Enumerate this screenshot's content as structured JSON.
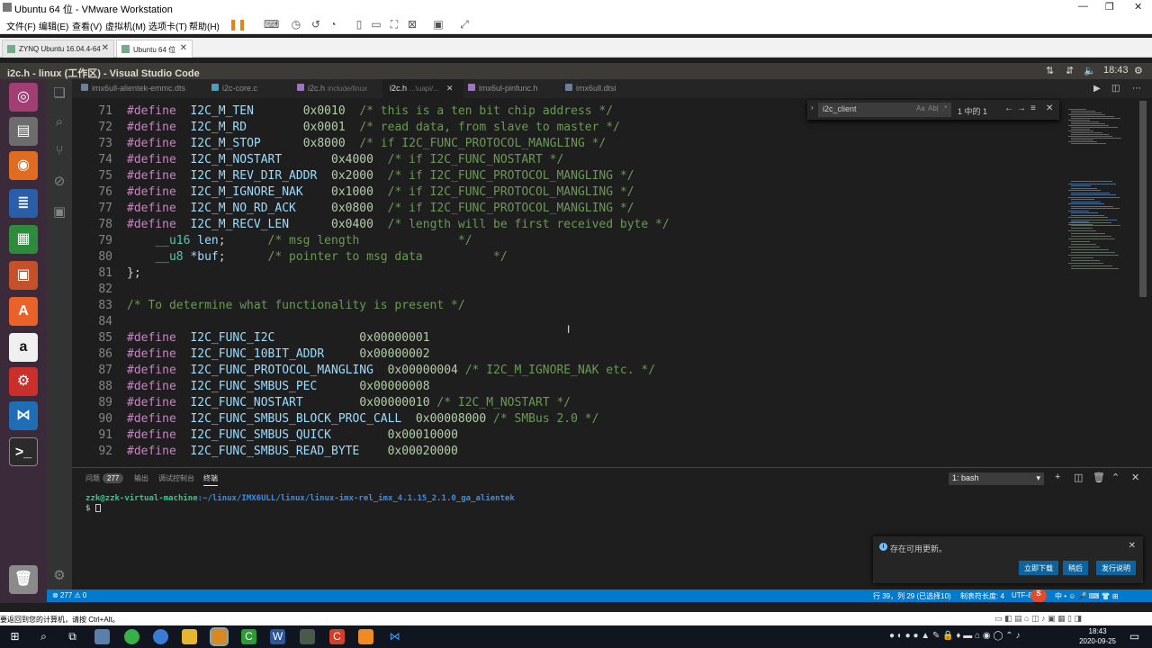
{
  "vm": {
    "window_title": "Ubuntu 64 位 - VMware Workstation",
    "menu": [
      "文件(F)",
      "编辑(E)",
      "查看(V)",
      "虚拟机(M)",
      "选项卡(T)",
      "帮助(H)"
    ],
    "tabs": [
      {
        "label": "ZYNQ Ubuntu 16.04.4-64"
      },
      {
        "label": "Ubuntu 64 位"
      }
    ],
    "hint": "要返回到您的计算机，请按 Ctrl+Alt。"
  },
  "ubuntu": {
    "window_title": "i2c.h - linux (工作区) - Visual Studio Code",
    "time": "18:43"
  },
  "editor_tabs": [
    {
      "label": "imx6ull-alientek-emmc.dts",
      "desc": "",
      "color": "#6b7e9a"
    },
    {
      "label": "i2c-core.c",
      "desc": "",
      "color": "#519aba"
    },
    {
      "label": "i2c.h",
      "desc": "include/linux",
      "color": "#a074c4"
    },
    {
      "label": "i2c.h",
      "desc": "...\\uapi/...",
      "color": "#a074c4"
    },
    {
      "label": "imx6ul-pinfunc.h",
      "desc": "",
      "color": "#a074c4"
    },
    {
      "label": "imx6ull.dtsi",
      "desc": "",
      "color": "#6b7e9a"
    }
  ],
  "find": {
    "value": "i2c_client",
    "opts": [
      "Aa",
      "Ab|",
      ".*"
    ],
    "count": "1 中的 1"
  },
  "code_lines": [
    {
      "n": "71",
      "parts": [
        [
          "kw",
          "#define"
        ],
        [
          "",
          "  "
        ],
        [
          "mac",
          "I2C_M_TEN"
        ],
        [
          "",
          "       "
        ],
        [
          "num",
          "0x0010"
        ],
        [
          "cm",
          "  /* this is a ten bit chip address */"
        ]
      ]
    },
    {
      "n": "72",
      "parts": [
        [
          "kw",
          "#define"
        ],
        [
          "",
          "  "
        ],
        [
          "mac",
          "I2C_M_RD"
        ],
        [
          "",
          "        "
        ],
        [
          "num",
          "0x0001"
        ],
        [
          "cm",
          "  /* read data, from slave to master */"
        ]
      ]
    },
    {
      "n": "73",
      "parts": [
        [
          "kw",
          "#define"
        ],
        [
          "",
          "  "
        ],
        [
          "mac",
          "I2C_M_STOP"
        ],
        [
          "",
          "      "
        ],
        [
          "num",
          "0x8000"
        ],
        [
          "cm",
          "  /* if I2C_FUNC_PROTOCOL_MANGLING */"
        ]
      ]
    },
    {
      "n": "74",
      "parts": [
        [
          "kw",
          "#define"
        ],
        [
          "",
          "  "
        ],
        [
          "mac",
          "I2C_M_NOSTART"
        ],
        [
          "",
          "       "
        ],
        [
          "num",
          "0x4000"
        ],
        [
          "cm",
          "  /* if I2C_FUNC_NOSTART */"
        ]
      ]
    },
    {
      "n": "75",
      "parts": [
        [
          "kw",
          "#define"
        ],
        [
          "",
          "  "
        ],
        [
          "mac",
          "I2C_M_REV_DIR_ADDR"
        ],
        [
          "",
          "  "
        ],
        [
          "num",
          "0x2000"
        ],
        [
          "cm",
          "  /* if I2C_FUNC_PROTOCOL_MANGLING */"
        ]
      ]
    },
    {
      "n": "76",
      "parts": [
        [
          "kw",
          "#define"
        ],
        [
          "",
          "  "
        ],
        [
          "mac",
          "I2C_M_IGNORE_NAK"
        ],
        [
          "",
          "    "
        ],
        [
          "num",
          "0x1000"
        ],
        [
          "cm",
          "  /* if I2C_FUNC_PROTOCOL_MANGLING */"
        ]
      ]
    },
    {
      "n": "77",
      "parts": [
        [
          "kw",
          "#define"
        ],
        [
          "",
          "  "
        ],
        [
          "mac",
          "I2C_M_NO_RD_ACK"
        ],
        [
          "",
          "     "
        ],
        [
          "num",
          "0x0800"
        ],
        [
          "cm",
          "  /* if I2C_FUNC_PROTOCOL_MANGLING */"
        ]
      ]
    },
    {
      "n": "78",
      "parts": [
        [
          "kw",
          "#define"
        ],
        [
          "",
          "  "
        ],
        [
          "mac",
          "I2C_M_RECV_LEN"
        ],
        [
          "",
          "      "
        ],
        [
          "num",
          "0x0400"
        ],
        [
          "cm",
          "  /* length will be first received byte */"
        ]
      ]
    },
    {
      "n": "79",
      "parts": [
        [
          "",
          "    "
        ],
        [
          "ty",
          "__u16"
        ],
        [
          "mac",
          " len"
        ],
        [
          "",
          ";"
        ],
        [
          "cm",
          "      /* msg length              */"
        ]
      ]
    },
    {
      "n": "80",
      "parts": [
        [
          "",
          "    "
        ],
        [
          "ty",
          "__u8"
        ],
        [
          "",
          ""
        ],
        [
          "mac",
          " *buf"
        ],
        [
          "",
          ";"
        ],
        [
          "cm",
          "      /* pointer to msg data          */"
        ]
      ]
    },
    {
      "n": "81",
      "parts": [
        [
          "",
          "};"
        ]
      ]
    },
    {
      "n": "82",
      "parts": [
        [
          "",
          ""
        ]
      ]
    },
    {
      "n": "83",
      "parts": [
        [
          "cm",
          "/* To determine what functionality is present */"
        ]
      ]
    },
    {
      "n": "84",
      "parts": [
        [
          "",
          ""
        ]
      ]
    },
    {
      "n": "85",
      "parts": [
        [
          "kw",
          "#define"
        ],
        [
          "",
          "  "
        ],
        [
          "mac",
          "I2C_FUNC_I2C"
        ],
        [
          "",
          "            "
        ],
        [
          "num",
          "0x00000001"
        ]
      ]
    },
    {
      "n": "86",
      "parts": [
        [
          "kw",
          "#define"
        ],
        [
          "",
          "  "
        ],
        [
          "mac",
          "I2C_FUNC_10BIT_ADDR"
        ],
        [
          "",
          "     "
        ],
        [
          "num",
          "0x00000002"
        ]
      ]
    },
    {
      "n": "87",
      "parts": [
        [
          "kw",
          "#define"
        ],
        [
          "",
          "  "
        ],
        [
          "mac",
          "I2C_FUNC_PROTOCOL_MANGLING"
        ],
        [
          "",
          "  "
        ],
        [
          "num",
          "0x00000004"
        ],
        [
          "cm",
          " /* I2C_M_IGNORE_NAK etc. */"
        ]
      ]
    },
    {
      "n": "88",
      "parts": [
        [
          "kw",
          "#define"
        ],
        [
          "",
          "  "
        ],
        [
          "mac",
          "I2C_FUNC_SMBUS_PEC"
        ],
        [
          "",
          "      "
        ],
        [
          "num",
          "0x00000008"
        ]
      ]
    },
    {
      "n": "89",
      "parts": [
        [
          "kw",
          "#define"
        ],
        [
          "",
          "  "
        ],
        [
          "mac",
          "I2C_FUNC_NOSTART"
        ],
        [
          "",
          "        "
        ],
        [
          "num",
          "0x00000010"
        ],
        [
          "cm",
          " /* I2C_M_NOSTART */"
        ]
      ]
    },
    {
      "n": "90",
      "parts": [
        [
          "kw",
          "#define"
        ],
        [
          "",
          "  "
        ],
        [
          "mac",
          "I2C_FUNC_SMBUS_BLOCK_PROC_CALL"
        ],
        [
          "",
          "  "
        ],
        [
          "num",
          "0x00008000"
        ],
        [
          "cm",
          " /* SMBus 2.0 */"
        ]
      ]
    },
    {
      "n": "91",
      "parts": [
        [
          "kw",
          "#define"
        ],
        [
          "",
          "  "
        ],
        [
          "mac",
          "I2C_FUNC_SMBUS_QUICK"
        ],
        [
          "",
          "        "
        ],
        [
          "num",
          "0x00010000"
        ]
      ]
    },
    {
      "n": "92",
      "parts": [
        [
          "kw",
          "#define"
        ],
        [
          "",
          "  "
        ],
        [
          "mac",
          "I2C_FUNC_SMBUS_READ_BYTE"
        ],
        [
          "",
          "    "
        ],
        [
          "num",
          "0x00020000"
        ]
      ]
    }
  ],
  "panel": {
    "tabs": [
      "问题",
      "输出",
      "调试控制台",
      "终端"
    ],
    "problem_count": "277",
    "terminal_select": "1: bash",
    "term_user": "zzk@zzk-virtual-machine",
    "term_path": ":~/linux/IMX6ULL/linux/linux-imx-rel_imx_4.1.15_2.1.0_ga_alientek",
    "term_prompt": "$ "
  },
  "notification": {
    "message": "存在可用更新。",
    "buttons": [
      "立即下载",
      "稍后",
      "发行说明"
    ]
  },
  "status": {
    "errors": "277",
    "warnings": "0",
    "position": "行 39，列 29 (已选择10)",
    "indent": "制表符长度: 4",
    "encoding": "UTF-8"
  },
  "taskbar": {
    "time": "18:43",
    "date": "2020-09-25"
  }
}
